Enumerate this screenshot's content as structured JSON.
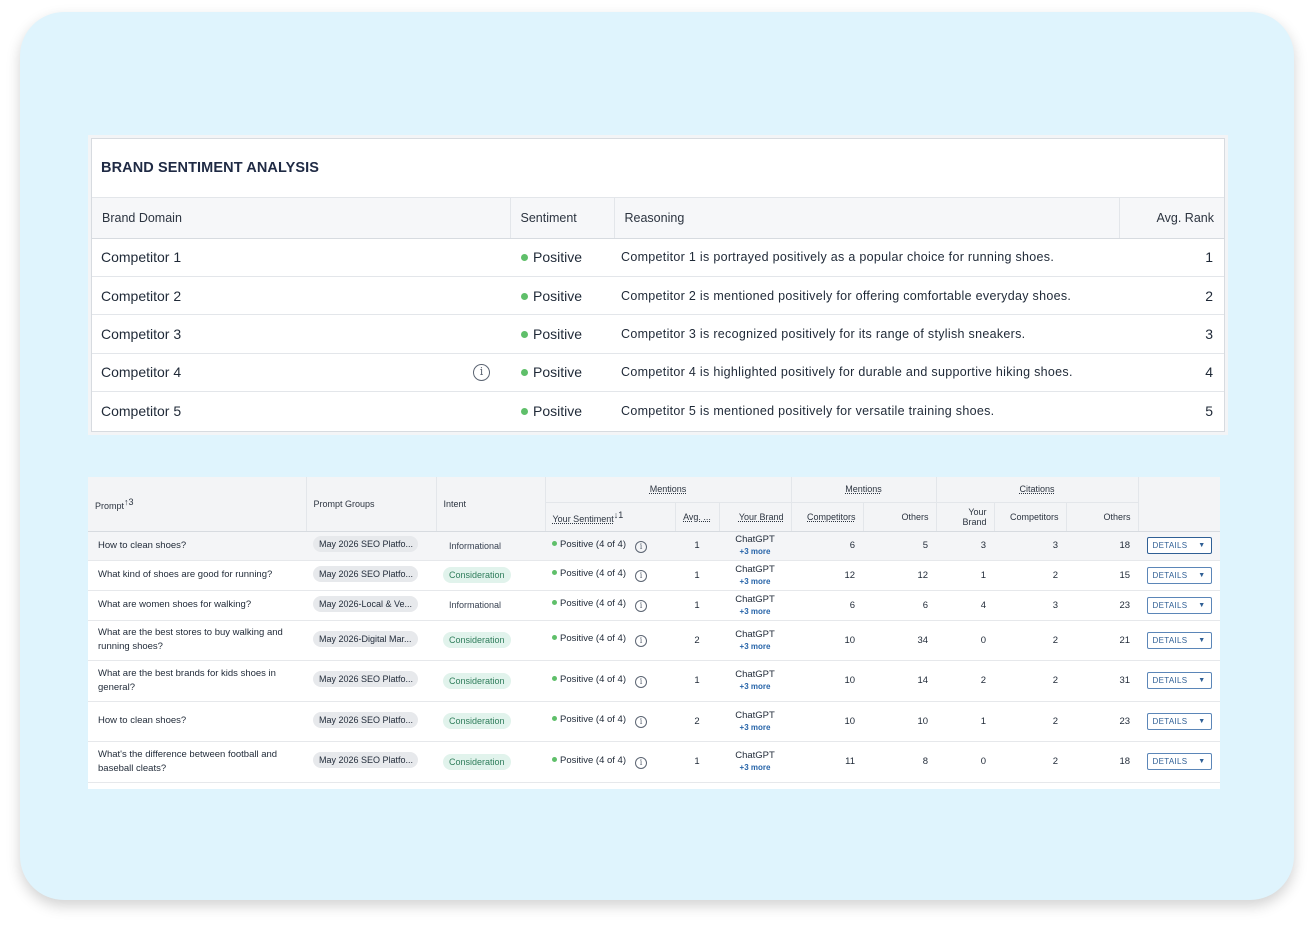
{
  "sentiment_card": {
    "title": "BRAND SENTIMENT ANALYSIS",
    "columns": {
      "brand_domain": "Brand Domain",
      "sentiment": "Sentiment",
      "reasoning": "Reasoning",
      "avg_rank": "Avg. Rank"
    },
    "rows": [
      {
        "domain": "Competitor 1",
        "sentiment": "Positive",
        "reasoning": "Competitor 1 is portrayed positively as a popular choice for running shoes.",
        "rank": "1"
      },
      {
        "domain": "Competitor 2",
        "sentiment": "Positive",
        "reasoning": "Competitor 2 is mentioned positively for offering comfortable everyday shoes.",
        "rank": "2"
      },
      {
        "domain": "Competitor 3",
        "sentiment": "Positive",
        "reasoning": "Competitor 3 is recognized positively for its range of stylish sneakers.",
        "rank": "3"
      },
      {
        "domain": "Competitor 4",
        "sentiment": "Positive",
        "reasoning": "Competitor 4 is highlighted positively for durable and supportive hiking shoes.",
        "rank": "4"
      },
      {
        "domain": "Competitor 5",
        "sentiment": "Positive",
        "reasoning": "Competitor 5 is mentioned positively for versatile training shoes.",
        "rank": "5"
      }
    ],
    "sentiment_color": "#5fbf6a"
  },
  "prompts_table": {
    "headers": {
      "prompt": "Prompt",
      "prompt_sort": "3",
      "prompt_groups": "Prompt Groups",
      "intent": "Intent",
      "mentions_group_1": "Mentions",
      "your_sentiment": "Your Sentiment",
      "sentiment_sort": "1",
      "avg": "Avg. ...",
      "your_brand": "Your Brand",
      "mentions_group_2": "Mentions",
      "competitors": "Competitors",
      "others": "Others",
      "citations_group": "Citations",
      "cit_your_brand": "Your Brand",
      "cit_competitors": "Competitors",
      "cit_others": "Others"
    },
    "rows": [
      {
        "prompt": "How to clean shoes?",
        "group": "May 2026 SEO Platfo...",
        "intent": "Informational",
        "sentiment": "Positive (4 of 4)",
        "avg": "1",
        "brand": "ChatGPT",
        "more": "+3 more",
        "m_comp": "6",
        "m_others": "5",
        "c_brand": "3",
        "c_comp": "3",
        "c_others": "18",
        "details": "DETAILS"
      },
      {
        "prompt": "What kind of shoes are good for running?",
        "group": "May 2026 SEO Platfo...",
        "intent": "Consideration",
        "sentiment": "Positive (4 of 4)",
        "avg": "1",
        "brand": "ChatGPT",
        "more": "+3 more",
        "m_comp": "12",
        "m_others": "12",
        "c_brand": "1",
        "c_comp": "2",
        "c_others": "15",
        "details": "DETAILS"
      },
      {
        "prompt": "What are women shoes for walking?",
        "group": "May 2026-Local & Ve...",
        "intent": "Informational",
        "sentiment": "Positive (4 of 4)",
        "avg": "1",
        "brand": "ChatGPT",
        "more": "+3 more",
        "m_comp": "6",
        "m_others": "6",
        "c_brand": "4",
        "c_comp": "3",
        "c_others": "23",
        "details": "DETAILS"
      },
      {
        "prompt": "What are the best stores to buy walking and running shoes?",
        "group": "May 2026-Digital Mar...",
        "intent": "Consideration",
        "sentiment": "Positive (4 of 4)",
        "avg": "2",
        "brand": "ChatGPT",
        "more": "+3 more",
        "m_comp": "10",
        "m_others": "34",
        "c_brand": "0",
        "c_comp": "2",
        "c_others": "21",
        "details": "DETAILS"
      },
      {
        "prompt": "What are the best brands for kids shoes in general?",
        "group": "May 2026 SEO Platfo...",
        "intent": "Consideration",
        "sentiment": "Positive (4 of 4)",
        "avg": "1",
        "brand": "ChatGPT",
        "more": "+3 more",
        "m_comp": "10",
        "m_others": "14",
        "c_brand": "2",
        "c_comp": "2",
        "c_others": "31",
        "details": "DETAILS"
      },
      {
        "prompt": "How to clean shoes?",
        "group": "May 2026 SEO Platfo...",
        "intent": "Consideration",
        "sentiment": "Positive (4 of 4)",
        "avg": "2",
        "brand": "ChatGPT",
        "more": "+3 more",
        "m_comp": "10",
        "m_others": "10",
        "c_brand": "1",
        "c_comp": "2",
        "c_others": "23",
        "details": "DETAILS"
      },
      {
        "prompt": "What's the difference between football and baseball cleats?",
        "group": "May 2026 SEO Platfo...",
        "intent": "Consideration",
        "sentiment": "Positive (4 of 4)",
        "avg": "1",
        "brand": "ChatGPT",
        "more": "+3 more",
        "m_comp": "11",
        "m_others": "8",
        "c_brand": "0",
        "c_comp": "2",
        "c_others": "18",
        "details": "DETAILS"
      }
    ],
    "row_heights": null
  },
  "icons": {
    "info": "info-circle-icon",
    "sort_up": "arrow-up-icon",
    "sort_down": "arrow-down-icon",
    "dropdown": "caret-down-icon"
  },
  "colors": {
    "background": "#dff4fd",
    "positive": "#5fbf6a",
    "consideration_bg": "#e1f3ec",
    "consideration_text": "#2f7d5b",
    "link_blue": "#2563a8"
  }
}
